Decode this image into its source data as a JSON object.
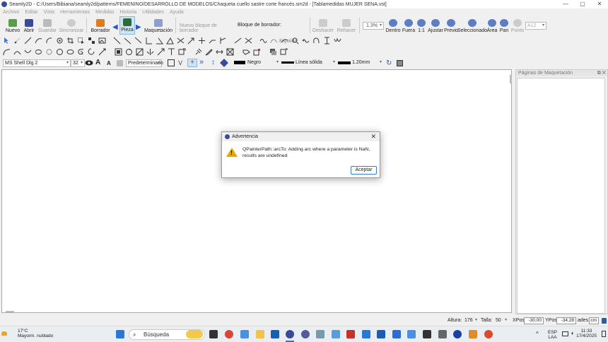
{
  "window": {
    "title": "Seamly2D - C:/Users/Bibiana/seamly2d/patterns/FEMENINO/DESARROLLO DE MODELOS/Chaqueta cuello sastre corte francés.sm2d - [Tablamedidas MUJER SENA.vst]",
    "minimize": "—",
    "maximize": "▢",
    "close": "✕"
  },
  "menu": [
    "Archivo",
    "Editar",
    "Vista",
    "Herramientas",
    "Medidas",
    "Historia",
    "Utilidades",
    "Ayuda"
  ],
  "toolbar": {
    "nuevo": "Nuevo",
    "abrir": "Abrir",
    "guardar": "Guardar",
    "sincronizar": "Sincronizar",
    "borrador": "Borrador",
    "pieza": "Pieza",
    "maquetacion": "Maquetación",
    "nuevo_bloque": "Nuevo bloque de borrador",
    "bloque_label": "Bloque de borrador:",
    "bloque_value": "Espalda",
    "deshacer": "Deshacer",
    "rehacer": "Rehacer",
    "zoom_value": "1.3%",
    "dentro": "Dentro",
    "fuera": "Fuera",
    "uno_a_uno": "1:1",
    "ajustar": "Ajustar",
    "previo": "Previo",
    "seleccionado": "Seleccionado",
    "area": "Área",
    "pan": "Pan",
    "punto": "Punto",
    "point_combo": "A12"
  },
  "stylebar": {
    "font": "MS Shell Dlg 2",
    "size": "32",
    "bold_a": "A",
    "small_a": "A",
    "style": "Predeterminado",
    "color": "Negro",
    "line": "Línea sólida",
    "width": "1.20mm"
  },
  "sidepanel": {
    "title": "Páginas de Maquetación",
    "buttons": "⧉ ✕"
  },
  "status": {
    "altura_label": "Altura:",
    "altura": "176",
    "talla_label": "Talla:",
    "talla": "50",
    "xpos_label": "XPos:",
    "xpos": "-30,00",
    "ypos_label": "YPos:",
    "ypos": "-34,28",
    "units_label": "ades:",
    "units": "cm"
  },
  "dialog": {
    "title": "Advertencia",
    "message": "QPainterPath::arcTo: Adding arc where a parameter is NaN, results are undefined",
    "ok": "Aceptar",
    "close": "✕"
  },
  "taskbar": {
    "temp": "17°C",
    "weather": "Mayorm. nublado",
    "search": "Búsqueda",
    "lang1": "ESP",
    "lang2": "LAA",
    "time": "11:33",
    "date": "17/4/2025"
  },
  "colors": {
    "accent": "#3a7bd5",
    "warning": "#e0a800",
    "app": "#3a4a9a"
  }
}
